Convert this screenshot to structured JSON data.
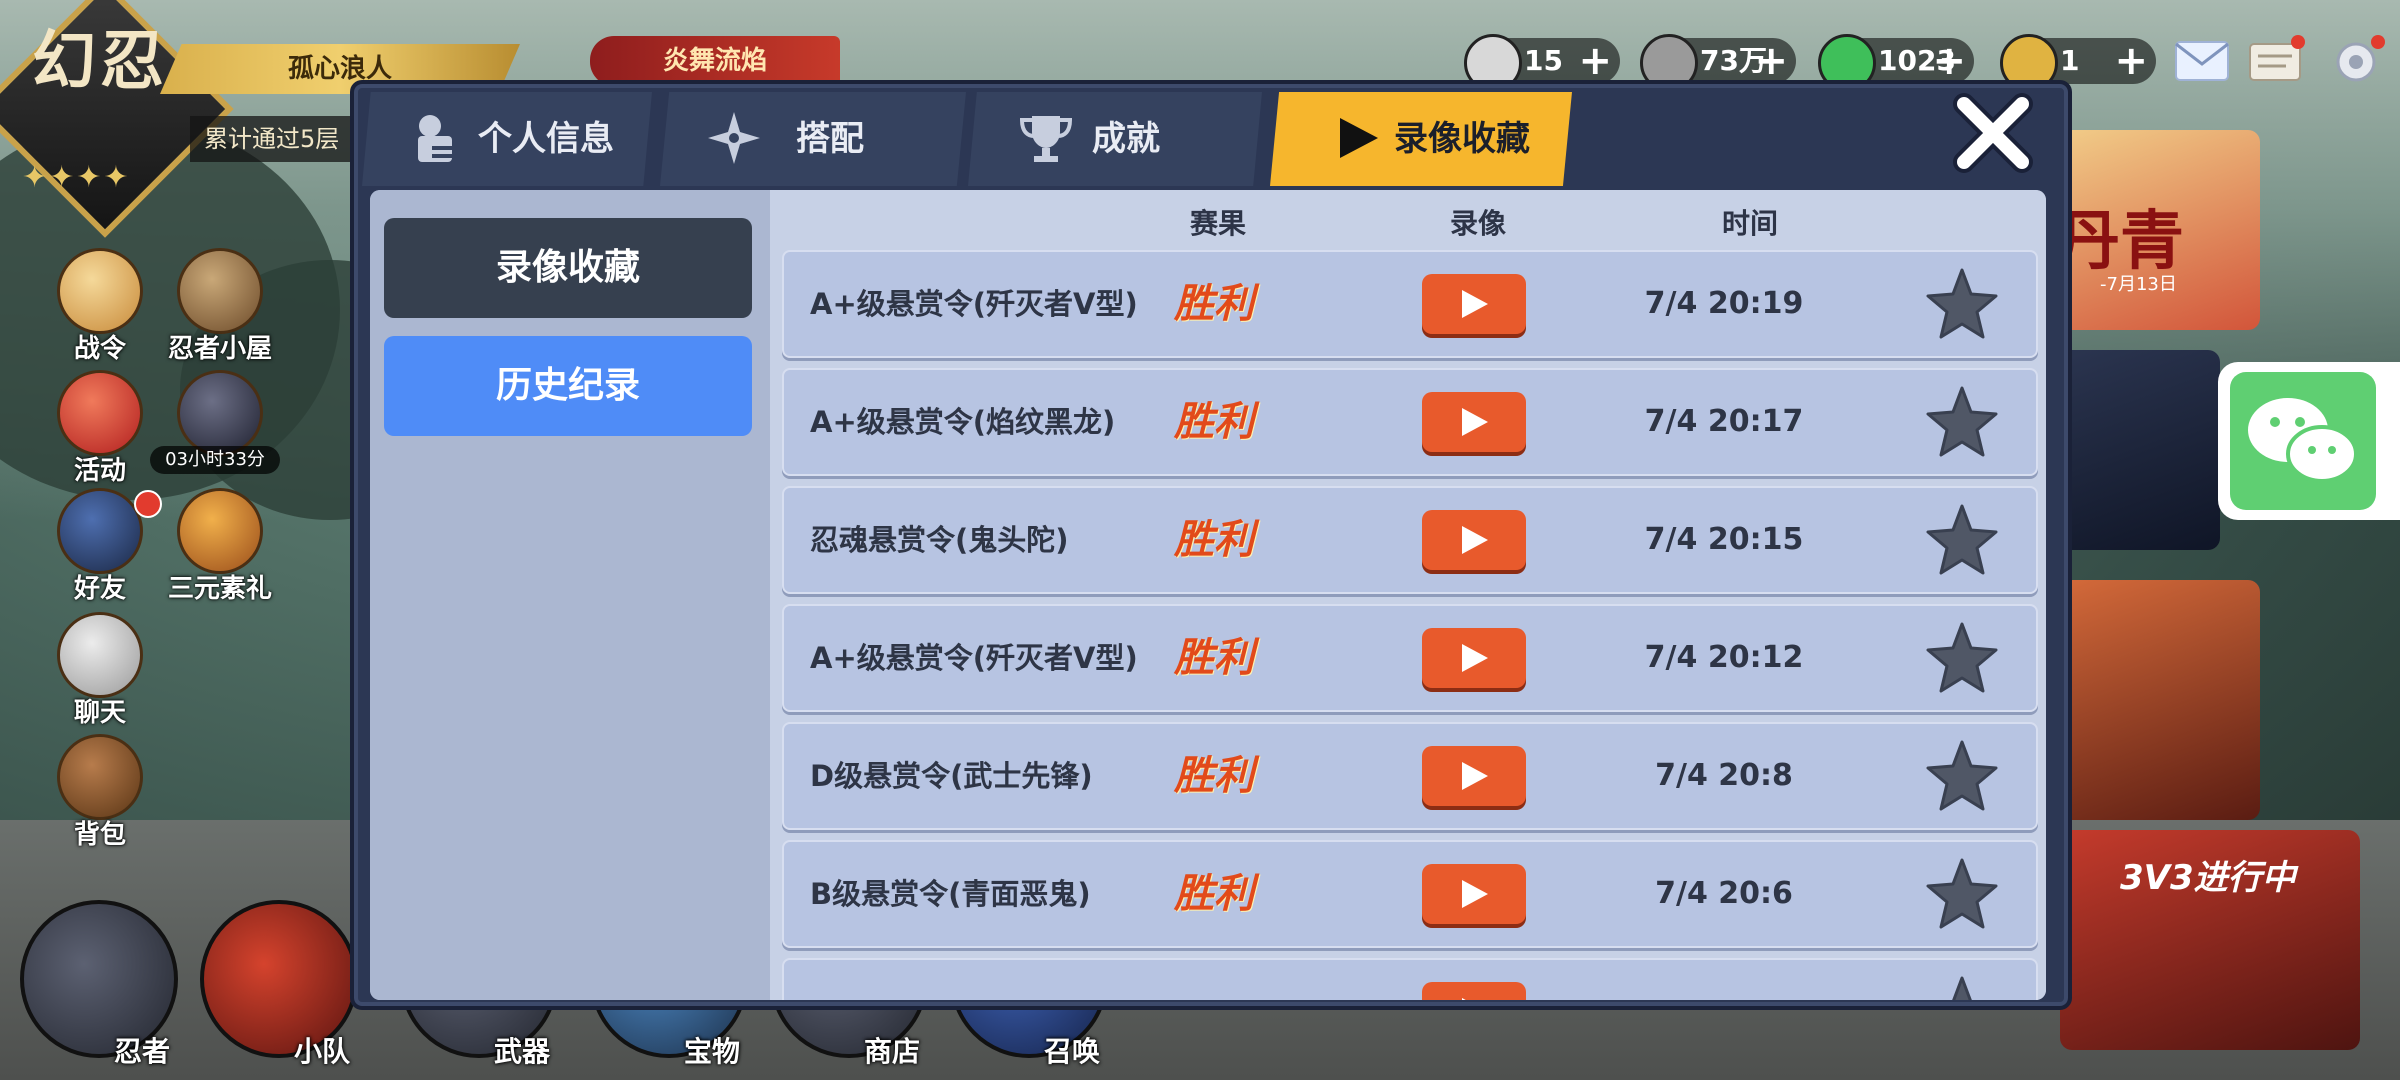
{
  "header": {
    "logo_text": "幻忍",
    "player_name": "孤心浪人",
    "progress_text": "累计通过5层",
    "event_tag": "炎舞流焰"
  },
  "resources": [
    {
      "name": "energy",
      "value": "15",
      "color": "#d8d8d8"
    },
    {
      "name": "coins",
      "value": "73万",
      "color": "#9a9a9a"
    },
    {
      "name": "jade",
      "value": "1023",
      "color": "#3fbf5a"
    },
    {
      "name": "token",
      "value": "1",
      "color": "#e0b341"
    }
  ],
  "left_menu": [
    {
      "label": "战令"
    },
    {
      "label": "忍者小屋"
    },
    {
      "label": "活动"
    },
    {
      "label": "好友"
    },
    {
      "label": "三元素礼"
    },
    {
      "label": "聊天"
    },
    {
      "label": "背包"
    }
  ],
  "timer_text": "03小时33分",
  "bottom_menu": [
    {
      "label": "忍者"
    },
    {
      "label": "小队"
    },
    {
      "label": "武器"
    },
    {
      "label": "宝物"
    },
    {
      "label": "商店"
    },
    {
      "label": "召唤"
    }
  ],
  "right_banners": {
    "banner1": "丹青",
    "banner1_date": "-7月13日",
    "banner2": "3V3进行中"
  },
  "modal": {
    "tabs": [
      {
        "label": "个人信息",
        "active": false,
        "icon": "profile-icon"
      },
      {
        "label": "搭配",
        "active": false,
        "icon": "shuriken-icon"
      },
      {
        "label": "成就",
        "active": false,
        "icon": "trophy-icon"
      },
      {
        "label": "录像收藏",
        "active": true,
        "icon": "play-icon"
      }
    ],
    "sidebar": {
      "buttons": [
        {
          "label": "录像收藏",
          "style": "dark"
        },
        {
          "label": "历史纪录",
          "style": "blue"
        }
      ]
    },
    "columns": {
      "result": "赛果",
      "replay": "录像",
      "time": "时间"
    },
    "rows": [
      {
        "title": "A+级悬赏令(歼灭者V型)",
        "result": "胜利",
        "time": "7/4 20:19"
      },
      {
        "title": "A+级悬赏令(焰纹黑龙)",
        "result": "胜利",
        "time": "7/4 20:17"
      },
      {
        "title": "忍魂悬赏令(鬼头陀)",
        "result": "胜利",
        "time": "7/4 20:15"
      },
      {
        "title": "A+级悬赏令(歼灭者V型)",
        "result": "胜利",
        "time": "7/4 20:12"
      },
      {
        "title": "D级悬赏令(武士先锋)",
        "result": "胜利",
        "time": "7/4 20:8"
      },
      {
        "title": "B级悬赏令(青面恶鬼)",
        "result": "胜利",
        "time": "7/4 20:6"
      }
    ]
  },
  "colors": {
    "active_tab": "#f6b62d",
    "blue_button": "#4f8cf7",
    "play_button": "#e85a2c",
    "victory_text": "#e24a1a"
  }
}
